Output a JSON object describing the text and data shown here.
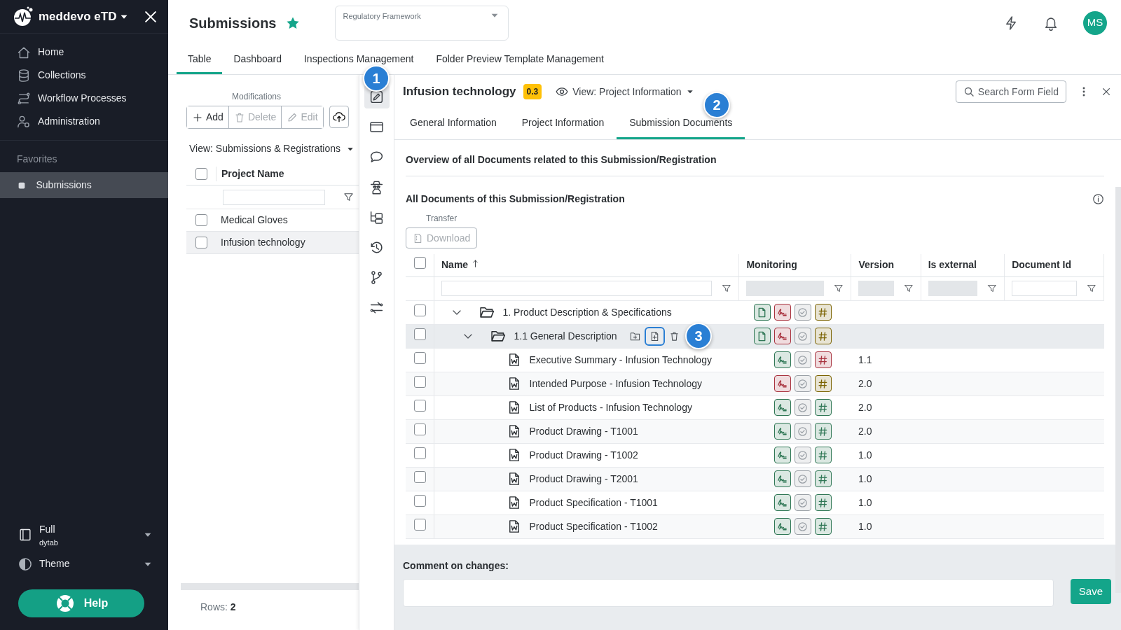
{
  "sidebar": {
    "brand": "meddevo eTD",
    "items": [
      {
        "label": "Home",
        "kind": "home",
        "selected": false
      },
      {
        "label": "Collections",
        "kind": "database",
        "selected": false
      },
      {
        "label": "Workflow Processes",
        "kind": "workflow",
        "selected": false
      },
      {
        "label": "Administration",
        "kind": "admin",
        "selected": false
      }
    ],
    "favorites_heading": "Favorites",
    "favorites": [
      {
        "label": "Submissions",
        "selected": true
      }
    ],
    "layout": {
      "label": "Full",
      "sublabel": "dytab"
    },
    "theme": {
      "label": "Theme"
    },
    "help_button": "Help"
  },
  "header": {
    "title": "Submissions",
    "favorite": true,
    "framework_select": {
      "label": "Regulatory Framework"
    },
    "avatar": "MS"
  },
  "tabs": [
    {
      "label": "Table",
      "selected": true
    },
    {
      "label": "Dashboard",
      "selected": false
    },
    {
      "label": "Inspections Management",
      "selected": false
    },
    {
      "label": "Folder Preview Template Management",
      "selected": false
    }
  ],
  "left_pane": {
    "toolbar_label": "Modifications",
    "buttons": [
      {
        "label": "Add",
        "kind": "add",
        "disabled": false
      },
      {
        "label": "Delete",
        "kind": "delete",
        "disabled": true
      },
      {
        "label": "Edit",
        "kind": "edit",
        "disabled": true
      }
    ],
    "view": "View: Submissions & Registrations",
    "column": "Project Name",
    "all_checked": false,
    "rows": [
      {
        "name": "Medical Gloves",
        "checked": false,
        "selected": false
      },
      {
        "name": "Infusion technology",
        "checked": false,
        "selected": true
      }
    ],
    "footer_label": "Rows:",
    "row_count": "2"
  },
  "side_tools": [
    {
      "kind": "edit",
      "selected": true
    },
    {
      "kind": "window",
      "selected": false
    },
    {
      "kind": "chat",
      "selected": false
    },
    {
      "kind": "spy",
      "selected": false
    },
    {
      "kind": "tree",
      "selected": false
    },
    {
      "kind": "history",
      "selected": false
    },
    {
      "kind": "branch",
      "selected": false
    },
    {
      "kind": "transfer",
      "selected": false
    }
  ],
  "detail": {
    "title": "Infusion technology",
    "version": "0.3",
    "view": "View: Project Information",
    "search_button": "Search Form Field",
    "tabs": [
      {
        "label": "General Information",
        "selected": false
      },
      {
        "label": "Project Information",
        "selected": false
      },
      {
        "label": "Submission Documents",
        "selected": true
      }
    ],
    "overview_heading": "Overview of all Documents related to this Submission/Registration",
    "section_heading": "All Documents of this Submission/Registration",
    "toolbar_label": "Transfer",
    "download_button": {
      "label": "Download",
      "disabled": true
    },
    "all_checked": false,
    "columns": [
      {
        "label": "Name",
        "sorted_ascending": true,
        "filter_disabled": false
      },
      {
        "label": "Monitoring",
        "filter_disabled": true
      },
      {
        "label": "Version",
        "filter_disabled": true
      },
      {
        "label": "Is external",
        "filter_disabled": true
      },
      {
        "label": "Document Id",
        "filter_disabled": false
      }
    ],
    "rows": [
      {
        "kind": "folder",
        "name": "1. Product Description & Specifications",
        "checked": false,
        "expanded": true,
        "selected": false,
        "monitoring": [
          {
            "kind": "document",
            "color": "#2e7654"
          },
          {
            "kind": "signature",
            "color": "#a8323e"
          },
          {
            "kind": "approval",
            "color": "#9aa0a6"
          },
          {
            "kind": "number",
            "color": "#7a6200"
          }
        ],
        "children": [
          {
            "kind": "folder",
            "name": "1.1 General Description",
            "checked": false,
            "expanded": true,
            "selected": true,
            "actions": [
              {
                "kind": "add-folder",
                "focused": false
              },
              {
                "kind": "add-file",
                "focused": true
              },
              {
                "kind": "delete",
                "focused": false
              }
            ],
            "monitoring": [
              {
                "kind": "document",
                "color": "#2e7654"
              },
              {
                "kind": "signature",
                "color": "#a8323e"
              },
              {
                "kind": "approval",
                "color": "#9aa0a6"
              },
              {
                "kind": "number",
                "color": "#7a6200"
              }
            ],
            "children": [
              {
                "kind": "document",
                "name": "Executive Summary - Infusion Technology",
                "checked": false,
                "selected": false,
                "version": "1.1",
                "monitoring": [
                  {
                    "kind": "signature",
                    "color": "#2e7654"
                  },
                  {
                    "kind": "approval",
                    "color": "#9aa0a6"
                  },
                  {
                    "kind": "number",
                    "color": "#a8323e"
                  }
                ]
              },
              {
                "kind": "document",
                "name": "Intended Purpose - Infusion Technology",
                "checked": false,
                "selected": false,
                "version": "2.0",
                "monitoring": [
                  {
                    "kind": "signature",
                    "color": "#a8323e"
                  },
                  {
                    "kind": "approval",
                    "color": "#9aa0a6"
                  },
                  {
                    "kind": "number",
                    "color": "#7a6200"
                  }
                ]
              },
              {
                "kind": "document",
                "name": "List of Products - Infusion Technology",
                "checked": false,
                "selected": false,
                "version": "2.0",
                "monitoring": [
                  {
                    "kind": "signature",
                    "color": "#2e7654"
                  },
                  {
                    "kind": "approval",
                    "color": "#9aa0a6"
                  },
                  {
                    "kind": "number",
                    "color": "#2e7654"
                  }
                ]
              },
              {
                "kind": "document",
                "name": "Product Drawing - T1001",
                "checked": false,
                "selected": false,
                "version": "2.0",
                "monitoring": [
                  {
                    "kind": "signature",
                    "color": "#2e7654"
                  },
                  {
                    "kind": "approval",
                    "color": "#9aa0a6"
                  },
                  {
                    "kind": "number",
                    "color": "#2e7654"
                  }
                ]
              },
              {
                "kind": "document",
                "name": "Product Drawing - T1002",
                "checked": false,
                "selected": false,
                "version": "1.0",
                "monitoring": [
                  {
                    "kind": "signature",
                    "color": "#2e7654"
                  },
                  {
                    "kind": "approval",
                    "color": "#9aa0a6"
                  },
                  {
                    "kind": "number",
                    "color": "#2e7654"
                  }
                ]
              },
              {
                "kind": "document",
                "name": "Product Drawing - T2001",
                "checked": false,
                "selected": false,
                "version": "1.0",
                "monitoring": [
                  {
                    "kind": "signature",
                    "color": "#2e7654"
                  },
                  {
                    "kind": "approval",
                    "color": "#9aa0a6"
                  },
                  {
                    "kind": "number",
                    "color": "#2e7654"
                  }
                ]
              },
              {
                "kind": "document",
                "name": "Product Specification - T1001",
                "checked": false,
                "selected": false,
                "version": "1.0",
                "monitoring": [
                  {
                    "kind": "signature",
                    "color": "#2e7654"
                  },
                  {
                    "kind": "approval",
                    "color": "#9aa0a6"
                  },
                  {
                    "kind": "number",
                    "color": "#2e7654"
                  }
                ]
              },
              {
                "kind": "document",
                "name": "Product Specification - T1002",
                "checked": false,
                "selected": false,
                "version": "1.0",
                "monitoring": [
                  {
                    "kind": "signature",
                    "color": "#2e7654"
                  },
                  {
                    "kind": "approval",
                    "color": "#9aa0a6"
                  },
                  {
                    "kind": "number",
                    "color": "#2e7654"
                  }
                ]
              }
            ]
          }
        ]
      }
    ]
  },
  "comment": {
    "label": "Comment on changes:",
    "save_button": "Save"
  },
  "callouts": [
    {
      "number": "1"
    },
    {
      "number": "2"
    },
    {
      "number": "3"
    }
  ]
}
